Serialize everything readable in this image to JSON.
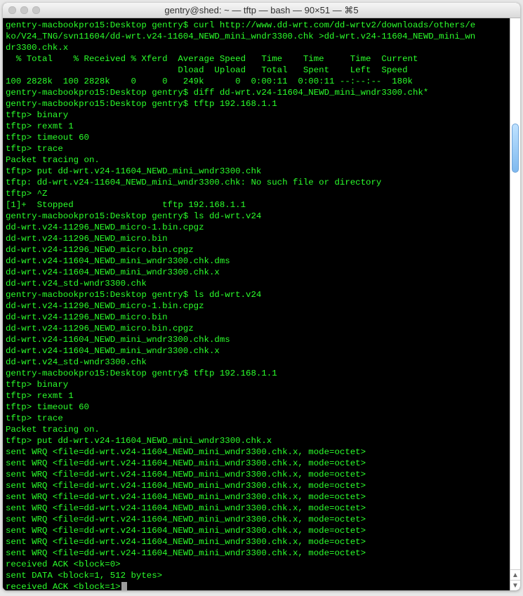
{
  "window": {
    "title": "gentry@shed: ~ — tftp — bash — 90×51 — ⌘5"
  },
  "terminal": {
    "prompt": "gentry-macbookpro15:Desktop gentry$ ",
    "tftp_prompt": "tftp> ",
    "lines": [
      "gentry-macbookpro15:Desktop gentry$ curl http://www.dd-wrt.com/dd-wrtv2/downloads/others/e",
      "ko/V24_TNG/svn11604/dd-wrt.v24-11604_NEWD_mini_wndr3300.chk >dd-wrt.v24-11604_NEWD_mini_wn",
      "dr3300.chk.x",
      "  % Total    % Received % Xferd  Average Speed   Time    Time     Time  Current",
      "                                 Dload  Upload   Total   Spent    Left  Speed",
      "100 2828k  100 2828k    0     0   249k      0  0:00:11  0:00:11 --:--:--  180k",
      "gentry-macbookpro15:Desktop gentry$ diff dd-wrt.v24-11604_NEWD_mini_wndr3300.chk*",
      "gentry-macbookpro15:Desktop gentry$ tftp 192.168.1.1",
      "tftp> binary",
      "tftp> rexmt 1",
      "tftp> timeout 60",
      "tftp> trace",
      "Packet tracing on.",
      "tftp> put dd-wrt.v24-11604_NEWD_mini_wndr3300.chk",
      "tftp: dd-wrt.v24-11604_NEWD_mini_wndr3300.chk: No such file or directory",
      "tftp> ^Z",
      "[1]+  Stopped                 tftp 192.168.1.1",
      "gentry-macbookpro15:Desktop gentry$ ls dd-wrt.v24",
      "dd-wrt.v24-11296_NEWD_micro-1.bin.cpgz",
      "dd-wrt.v24-11296_NEWD_micro.bin",
      "dd-wrt.v24-11296_NEWD_micro.bin.cpgz",
      "dd-wrt.v24-11604_NEWD_mini_wndr3300.chk.dms",
      "dd-wrt.v24-11604_NEWD_mini_wndr3300.chk.x",
      "dd-wrt.v24_std-wndr3300.chk",
      "gentry-macbookpro15:Desktop gentry$ ls dd-wrt.v24",
      "dd-wrt.v24-11296_NEWD_micro-1.bin.cpgz",
      "dd-wrt.v24-11296_NEWD_micro.bin",
      "dd-wrt.v24-11296_NEWD_micro.bin.cpgz",
      "dd-wrt.v24-11604_NEWD_mini_wndr3300.chk.dms",
      "dd-wrt.v24-11604_NEWD_mini_wndr3300.chk.x",
      "dd-wrt.v24_std-wndr3300.chk",
      "gentry-macbookpro15:Desktop gentry$ tftp 192.168.1.1",
      "tftp> binary",
      "tftp> rexmt 1",
      "tftp> timeout 60",
      "tftp> trace",
      "Packet tracing on.",
      "tftp> put dd-wrt.v24-11604_NEWD_mini_wndr3300.chk.x",
      "sent WRQ <file=dd-wrt.v24-11604_NEWD_mini_wndr3300.chk.x, mode=octet>",
      "sent WRQ <file=dd-wrt.v24-11604_NEWD_mini_wndr3300.chk.x, mode=octet>",
      "sent WRQ <file=dd-wrt.v24-11604_NEWD_mini_wndr3300.chk.x, mode=octet>",
      "sent WRQ <file=dd-wrt.v24-11604_NEWD_mini_wndr3300.chk.x, mode=octet>",
      "sent WRQ <file=dd-wrt.v24-11604_NEWD_mini_wndr3300.chk.x, mode=octet>",
      "sent WRQ <file=dd-wrt.v24-11604_NEWD_mini_wndr3300.chk.x, mode=octet>",
      "sent WRQ <file=dd-wrt.v24-11604_NEWD_mini_wndr3300.chk.x, mode=octet>",
      "sent WRQ <file=dd-wrt.v24-11604_NEWD_mini_wndr3300.chk.x, mode=octet>",
      "sent WRQ <file=dd-wrt.v24-11604_NEWD_mini_wndr3300.chk.x, mode=octet>",
      "sent WRQ <file=dd-wrt.v24-11604_NEWD_mini_wndr3300.chk.x, mode=octet>",
      "received ACK <block=0>",
      "sent DATA <block=1, 512 bytes>",
      "received ACK <block=1>"
    ]
  },
  "scrollbar": {
    "up": "▲",
    "down": "▼"
  }
}
